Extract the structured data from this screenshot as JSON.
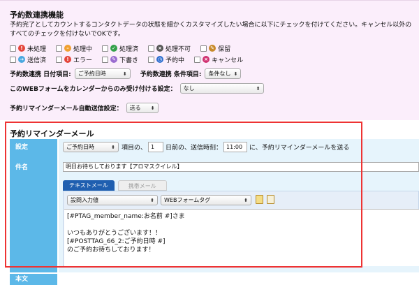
{
  "reservation_section": {
    "title": "予約数連携機能",
    "description": "予約完了としてカウントするコンタクトデータの状態を細かくカスタマイズしたい場合に以下にチェックを付けてください。キャンセル以外のすべてのチェックを付けないでOKです。",
    "statuses_row1": [
      {
        "label": "未処理",
        "color": "#e4463b",
        "glyph": "!"
      },
      {
        "label": "処理中",
        "color": "#f0a030",
        "glyph": "–"
      },
      {
        "label": "処理済",
        "color": "#33a04a",
        "glyph": "✓"
      },
      {
        "label": "処理不可",
        "color": "#555555",
        "glyph": "×"
      },
      {
        "label": "保留",
        "color": "#c88a2a",
        "glyph": "✎"
      }
    ],
    "statuses_row2": [
      {
        "label": "送信済",
        "color": "#4aa8e0",
        "glyph": "→"
      },
      {
        "label": "エラー",
        "color": "#e4463b",
        "glyph": "!"
      },
      {
        "label": "下書き",
        "color": "#9a6bd0",
        "glyph": "✎"
      },
      {
        "label": "予約中",
        "color": "#2f6fd0",
        "glyph": "◷"
      },
      {
        "label": "キャンセル",
        "color": "#d03070",
        "glyph": "×"
      }
    ],
    "date_item_label": "予約数連携 日付項目:",
    "date_item_value": "ご予約日時",
    "condition_label": "予約数連携 条件項目:",
    "condition_value": "条件なし",
    "calendar_only_label": "このWEBフォームをカレンダーからのみ受け付ける設定：",
    "calendar_only_value": "なし",
    "auto_reminder_label": "予約リマインダーメール自動送信設定：",
    "auto_reminder_value": "送る"
  },
  "reminder_section": {
    "title": "予約リマインダーメール",
    "setting_label": "設定",
    "item_select": "ご予約日時",
    "text_item_of": "項目の、",
    "days_value": "1",
    "text_days_before": "日前の、送信時刻：",
    "time_value": "11:00",
    "text_send": "に、予約リマインダーメールを送る",
    "subject_label": "件名",
    "subject_value": "明日お待ちしております【アロマスクイレル】",
    "tab_text": "テキストメール",
    "tab_mobile": "携帯メール",
    "insert_select": "設問入力値",
    "tag_select": "WEBフォームタグ",
    "body_lines": [
      "[#PTAG_member_name:お名前 #]さま",
      "",
      "いつもありがとうございます！！",
      "[#POSTTAG_66_2:ご予約日時 #]",
      "のご予約お待ちしております！"
    ],
    "body_label": "本文"
  }
}
